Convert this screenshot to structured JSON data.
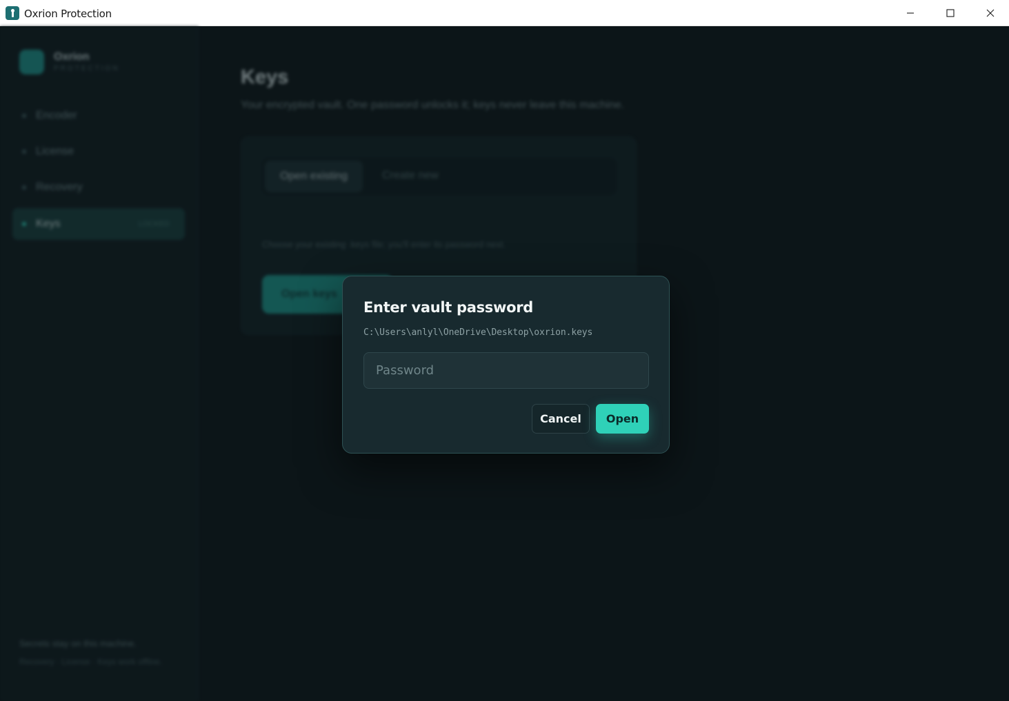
{
  "window": {
    "title": "Oxrion Protection",
    "icons": {
      "app": "keyhole-app-icon",
      "minimize": "minimize-icon",
      "maximize": "maximize-icon",
      "close": "close-icon"
    }
  },
  "sidebar": {
    "brand_name": "Oxrion",
    "brand_sub": "PROTECTION",
    "items": [
      {
        "label": "Encoder",
        "active": false
      },
      {
        "label": "License",
        "active": false
      },
      {
        "label": "Recovery",
        "active": false
      },
      {
        "label": "Keys",
        "active": true,
        "badge": "LOCKED"
      }
    ],
    "footer_line1": "Secrets stay on this machine.",
    "footer_line2": "Recovery · License · Keys work offline."
  },
  "main": {
    "title": "Keys",
    "subtitle": "Your encrypted vault. One password unlocks it; keys never leave this machine.",
    "tabs": [
      {
        "label": "Open existing",
        "selected": true
      },
      {
        "label": "Create new",
        "selected": false
      }
    ],
    "hint": "Choose your existing .keys file; you'll enter its password next.",
    "open_button": "Open keys"
  },
  "dialog": {
    "title": "Enter vault password",
    "path": "C:\\Users\\anlyl\\OneDrive\\Desktop\\oxrion.keys",
    "password_placeholder": "Password",
    "password_value": "",
    "cancel_label": "Cancel",
    "open_label": "Open"
  },
  "colors": {
    "accent": "#2fd1b8",
    "dialog_bg": "#182a2f",
    "app_bg": "#0c1518"
  }
}
